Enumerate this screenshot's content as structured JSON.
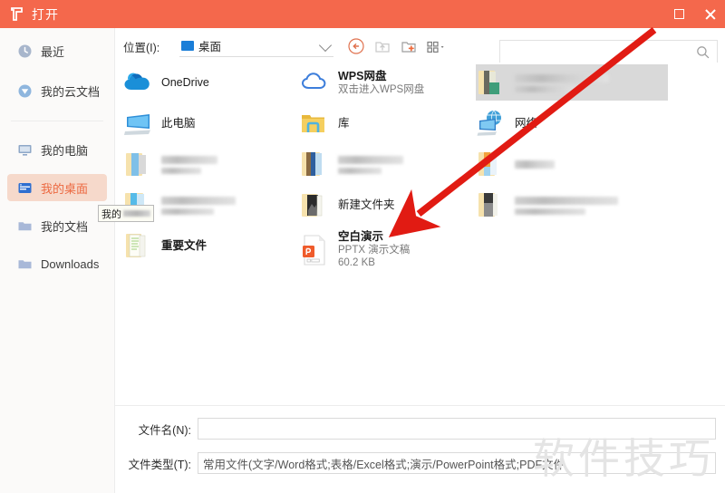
{
  "window": {
    "title": "打开",
    "logo_icon": "wps-logo-icon",
    "controls": [
      {
        "name": "maximize-button",
        "icon": "maximize-icon"
      },
      {
        "name": "close-button",
        "icon": "close-icon"
      }
    ],
    "titlebar_color": "#f4684c"
  },
  "sidebar": {
    "items": [
      {
        "label": "最近",
        "icon": "clock-icon",
        "selected": false
      },
      {
        "label": "我的云文档",
        "icon": "cloud-doc-icon",
        "selected": false
      },
      {
        "label": "我的电脑",
        "icon": "monitor-icon",
        "selected": false
      },
      {
        "label": "我的桌面",
        "icon": "desktop-icon",
        "selected": true
      },
      {
        "label": "我的文档",
        "icon": "folder-icon",
        "selected": false
      },
      {
        "label": "Downloads",
        "icon": "folder-icon",
        "selected": false
      }
    ],
    "selected_bg": "#f6d9cb",
    "selected_fg": "#ec6941"
  },
  "toolbar": {
    "location_label": "位置(I):",
    "location_value": "桌面",
    "location_icon": "monitor-blue-icon",
    "dropdown_icon": "chevron-down-icon",
    "buttons": [
      {
        "name": "back-button",
        "icon": "back-arrow-icon",
        "enabled": true
      },
      {
        "name": "up-folder-button",
        "icon": "up-folder-icon",
        "enabled": false
      },
      {
        "name": "new-folder-button",
        "icon": "new-folder-icon",
        "enabled": true
      },
      {
        "name": "view-mode-button",
        "icon": "grid-view-icon",
        "enabled": true
      }
    ]
  },
  "search": {
    "value": "",
    "placeholder": "",
    "icon": "search-icon"
  },
  "files": {
    "column1": [
      {
        "name": "OneDrive",
        "icon": "onedrive-icon",
        "sub": "",
        "blurred": false,
        "bold": false
      },
      {
        "name": "此电脑",
        "icon": "this-pc-icon",
        "sub": "",
        "blurred": false,
        "bold": false
      },
      {
        "name": "",
        "icon": "folder-stack-icon",
        "sub": "",
        "blurred": true,
        "bold": false
      },
      {
        "name": "",
        "icon": "folder-blue-icon",
        "sub": "",
        "blurred": true,
        "bold": false
      },
      {
        "name": "重要文件",
        "icon": "folder-docs-icon",
        "sub": "",
        "blurred": false,
        "bold": true
      }
    ],
    "column2": [
      {
        "name": "WPS网盘",
        "icon": "wps-cloud-icon",
        "sub": "双击进入WPS网盘",
        "blurred": false,
        "bold": true
      },
      {
        "name": "库",
        "icon": "library-icon",
        "sub": "",
        "blurred": false,
        "bold": false
      },
      {
        "name": "",
        "icon": "folder-books-icon",
        "sub": "",
        "blurred": true,
        "bold": false
      },
      {
        "name": "新建文件夹",
        "icon": "folder-photo-icon",
        "sub": "",
        "blurred": false,
        "bold": false
      },
      {
        "name": "空白演示",
        "icon": "pptx-file-icon",
        "sub": "PPTX 演示文稿",
        "sub2": "60.2 KB",
        "blurred": false,
        "bold": true
      }
    ],
    "column3": [
      {
        "name": "",
        "icon": "folder-green-icon",
        "sub": "",
        "blurred": true,
        "bold": false,
        "highlighted": true
      },
      {
        "name": "网络",
        "icon": "network-icon",
        "sub": "",
        "blurred": false,
        "bold": false
      },
      {
        "name": "",
        "icon": "folder-orange-icon",
        "sub": "",
        "blurred": true,
        "bold": false
      },
      {
        "name": "",
        "icon": "folder-gray-icon",
        "sub": "",
        "blurred": true,
        "bold": false
      }
    ]
  },
  "form": {
    "filename_label": "文件名(N):",
    "filename_value": "",
    "filetype_label": "文件类型(T):",
    "filetype_value": "常用文件(文字/Word格式;表格/Excel格式;演示/PowerPoint格式;PDF文件"
  },
  "tooltip": {
    "text": "我的"
  },
  "watermark": {
    "text": "软件技巧"
  },
  "annotation": {
    "arrow_color": "#e11b13",
    "arrow_from": "720,35",
    "arrow_to": "452,243"
  }
}
